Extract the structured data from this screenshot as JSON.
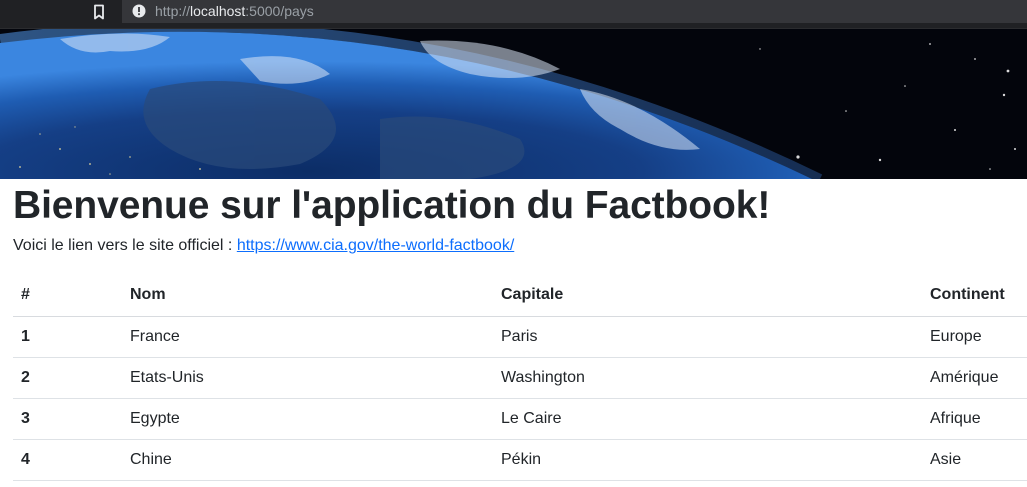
{
  "browser": {
    "url_scheme": "http://",
    "url_host": "localhost",
    "url_rest": ":5000/pays",
    "icons": {
      "bookmark": "bookmark-icon",
      "site_info": "info-icon"
    }
  },
  "banner": {
    "description_icon": "earth-from-space-banner"
  },
  "page": {
    "title": "Bienvenue sur l'application du Factbook!",
    "intro_text": "Voici le lien vers le site officiel : ",
    "link_text": "https://www.cia.gov/the-world-factbook/"
  },
  "table": {
    "headers": [
      "#",
      "Nom",
      "Capitale",
      "Continent"
    ],
    "rows": [
      {
        "id": "1",
        "nom": "France",
        "capitale": "Paris",
        "continent": "Europe"
      },
      {
        "id": "2",
        "nom": "Etats-Unis",
        "capitale": "Washington",
        "continent": "Amérique"
      },
      {
        "id": "3",
        "nom": "Egypte",
        "capitale": "Le Caire",
        "continent": "Afrique"
      },
      {
        "id": "4",
        "nom": "Chine",
        "capitale": "Pékin",
        "continent": "Asie"
      }
    ]
  },
  "colors": {
    "link": "#0d6efd",
    "chrome_bg": "#202124",
    "text": "#212529"
  }
}
